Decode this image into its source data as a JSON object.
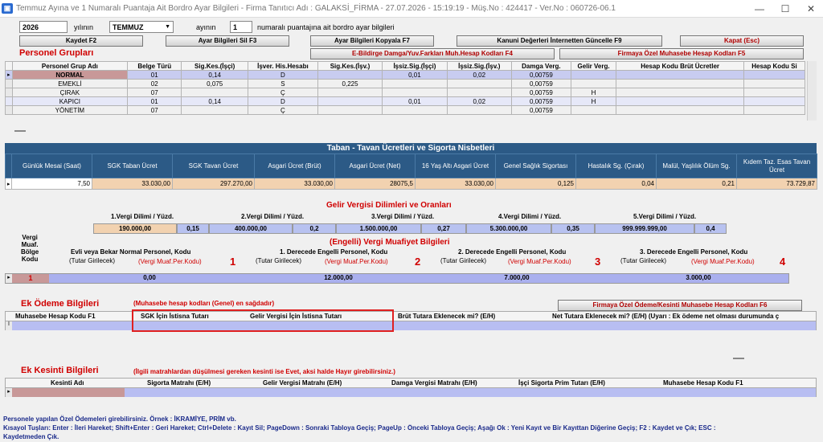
{
  "window": {
    "title": "Temmuz Ayına ve 1 Numaralı Puantaja Ait Bordro Ayar Bilgileri - Firma Tanıtıcı Adı : GALAKSİ_FİRMA - 27.07.2026 - 15:19:19 - Müş.No : 424417 - Ver.No : 060726-06.1",
    "minimize": "—",
    "maximize": "☐",
    "close": "✕"
  },
  "period": {
    "year": "2026",
    "year_label": "yılının",
    "month": "TEMMUZ",
    "month_label": "ayının",
    "puantaj": "1",
    "puantaj_label": "numaralı puantajına ait bordro ayar bilgileri"
  },
  "buttons": {
    "save": "Kaydet F2",
    "delete": "Ayar Bilgileri Sil F3",
    "copy": "Ayar Bilgileri Kopyala F7",
    "update": "Kanuni Değerleri İnternetten Güncelle F9",
    "close": "Kapat (Esc)",
    "edm": "E-Bildirge Damga/Yuv.Farkları Muh.Hesap Kodları F4",
    "firm_acc": "Firmaya Özel Muhasebe Hesap Kodları F5",
    "firm_pay": "Firmaya Özel Ödeme/Kesinti Muhasebe Hesap Kodları F6"
  },
  "personel": {
    "title": "Personel Grupları",
    "columns": [
      "Personel Grup Adı",
      "Belge Türü",
      "Sig.Kes.(İşçi)",
      "İşver. His.Hesabı",
      "Sig.Kes.(İşv.)",
      "İşsiz.Sig.(İşçi)",
      "İşsiz.Sig.(İşv.)",
      "Damga Verg.",
      "Gelir Verg.",
      "Hesap Kodu Brüt Ücretler",
      "Hesap Kodu Si"
    ],
    "rows": [
      [
        "NORMAL",
        "01",
        "0,14",
        "D",
        "",
        "0,01",
        "0,02",
        "0,00759",
        "",
        "",
        ""
      ],
      [
        "EMEKLİ",
        "02",
        "0,075",
        "S",
        "0,225",
        "",
        "",
        "0,00759",
        "",
        "",
        ""
      ],
      [
        "ÇIRAK",
        "07",
        "",
        "Ç",
        "",
        "",
        "",
        "0,00759",
        "H",
        "",
        ""
      ],
      [
        "KAPICI",
        "01",
        "0,14",
        "D",
        "",
        "0,01",
        "0,02",
        "0,00759",
        "H",
        "",
        ""
      ],
      [
        "YÖNETİM",
        "07",
        "",
        "Ç",
        "",
        "",
        "",
        "0,00759",
        "",
        "",
        ""
      ]
    ]
  },
  "taban": {
    "title": "Taban - Tavan Ücretleri ve Sigorta Nisbetleri",
    "columns": [
      "Günlük Mesai (Saat)",
      "SGK Taban Ücret",
      "SGK Tavan Ücret",
      "Asgari Ücret (Brüt)",
      "Asgari Ücret (Net)",
      "16 Yaş Altı Asgari Ücret",
      "Genel Sağlık Sigortası",
      "Hastalık Sg. (Çırak)",
      "Malül, Yaşlılık Ölüm Sg.",
      "Kıdem Taz. Esas Tavan Ücret"
    ],
    "values": [
      "7,50",
      "33.030,00",
      "297.270,00",
      "33.030,00",
      "28075,5",
      "33.030,00",
      "0,125",
      "0,04",
      "0,21",
      "73.729,87"
    ]
  },
  "gelir": {
    "title": "Gelir Vergisi Dilimleri ve Oranları",
    "labels": [
      "1.Vergi Dilimi  /  Yüzd.",
      "2.Vergi Dilimi  /  Yüzd.",
      "3.Vergi Dilimi  /  Yüzd.",
      "4.Vergi Dilimi  /  Yüzd.",
      "5.Vergi Dilimi  /  Yüzd."
    ],
    "amounts": [
      "190.000,00",
      "400.000,00",
      "1.500.000,00",
      "5.300.000,00",
      "999.999.999,00"
    ],
    "rates": [
      "0,15",
      "0,2",
      "0,27",
      "0,35",
      "0,4"
    ]
  },
  "muafiyet": {
    "title": "(Engelli) Vergi Muafiyet Bilgileri",
    "left_label": "Vergi\nMuaf.\nBölge\nKodu",
    "headers": [
      "Evli veya Bekar Normal Personel, Kodu",
      "1. Derecede Engelli Personel, Kodu",
      "2. Derecede Engelli Personel, Kodu",
      "3. Derecede Engelli Personel, Kodu"
    ],
    "tutar": "(Tutar Girilecek)",
    "vergi": "(Vergi Muaf.Per.Kodu)",
    "nums": [
      "1",
      "2",
      "3",
      "4"
    ],
    "code": "1",
    "values": [
      "0,00",
      "12.000,00",
      "7.000,00",
      "3.000,00"
    ]
  },
  "ek_odeme": {
    "title": "Ek Ödeme Bilgileri",
    "note": "(Muhasebe hesap kodları (Genel) en sağdadır)",
    "columns": [
      "Muhasebe Hesap Kodu F1",
      "SGK İçin İstisna Tutarı",
      "Gelir Vergisi İçin İstisna Tutarı",
      "Brüt Tutara Eklenecek mi? (E/H)",
      "Net Tutara Eklenecek mi? (E/H) (Uyarı : Ek ödeme net olması durumunda ç"
    ]
  },
  "ek_kesinti": {
    "title": "Ek Kesinti Bilgileri",
    "note": "(İlgili matrahlardan düşülmesi gereken kesinti ise Evet, aksi halde Hayır girebilirsiniz.)",
    "columns": [
      "Kesinti Adı",
      "Sigorta Matrahı (E/H)",
      "Gelir Vergisi Matrahı (E/H)",
      "Damga Vergisi Matrahı (E/H)",
      "İşçi Sigorta Prim Tutarı (E/H)",
      "Muhasebe Hesap Kodu F1"
    ]
  },
  "footer": {
    "line1": "Personele yapılan Özel Ödemeleri girebilirsiniz. Örnek : İKRAMİYE, PRİM vb.",
    "line2": "Kısayol Tuşları: Enter : İleri Hareket; Shift+Enter : Geri Hareket; Ctrl+Delete : Kayıt Sil; PageDown : Sonraki Tabloya Geçiş; PageUp : Önceki Tabloya Geçiş; Aşağı Ok : Yeni Kayıt ve Bir Kayıttan Diğerine Geçiş; F2 : Kaydet ve Çık; ESC :",
    "line3": "Kaydetmeden Çık."
  },
  "colors": {
    "accent_red": "#d00000",
    "header_blue": "#2c5a86",
    "row_lavender": "#b8bef2",
    "value_peach": "#f2d2b0"
  }
}
